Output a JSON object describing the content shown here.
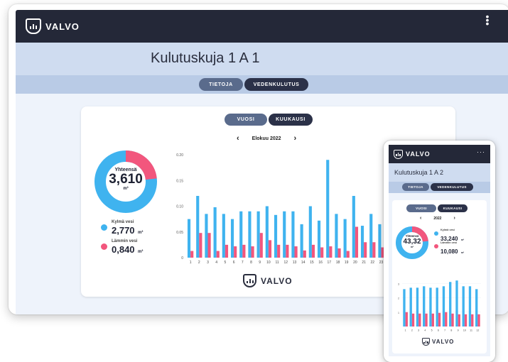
{
  "brand": {
    "name": "VALVO"
  },
  "desktop": {
    "title": "Kulutuskuja 1 A 1",
    "tabs": [
      "TIETOJA",
      "VEDENKULUTUS"
    ],
    "period_tabs": [
      "VUOSI",
      "KUUKAUSI"
    ],
    "month_label": "Elokuu 2022",
    "prev": "‹",
    "next": "›",
    "total_label": "Yhteensä",
    "total_value": "3,610",
    "total_unit": "m³",
    "cold_label": "Kylmä vesi",
    "cold_value": "2,770",
    "cold_unit": "m³",
    "warm_label": "Lämmin vesi",
    "warm_value": "0,840",
    "warm_unit": "m³"
  },
  "mobile": {
    "title": "Kulutuskuja 1 A 2",
    "tabs": [
      "TIETOJA",
      "VEDENKULUTUS"
    ],
    "period_tabs": [
      "VUOSI",
      "KUUKAUSI"
    ],
    "year_label": "2022",
    "prev": "‹",
    "next": "›",
    "total_label": "Yhteensä",
    "total_value": "43,32",
    "total_unit": "m³",
    "cold_label": "Kylmä vesi",
    "cold_value": "33,240",
    "cold_unit": "m³",
    "warm_label": "Lämmin vesi",
    "warm_value": "10,080",
    "warm_unit": "m³",
    "menu": "···"
  },
  "colors": {
    "cold": "#3fb3ef",
    "warm": "#f2567d",
    "dark": "#242838"
  },
  "chart_data": [
    {
      "type": "bar",
      "categories": [
        "1",
        "2",
        "3",
        "4",
        "5",
        "6",
        "7",
        "8",
        "9",
        "10",
        "11",
        "12",
        "13",
        "14",
        "15",
        "16",
        "17",
        "18",
        "19",
        "20",
        "21",
        "22",
        "23",
        "24",
        "25"
      ],
      "series": [
        {
          "name": "Kylmä vesi",
          "values": [
            0.075,
            0.12,
            0.085,
            0.098,
            0.085,
            0.075,
            0.09,
            0.09,
            0.09,
            0.1,
            0.083,
            0.09,
            0.09,
            0.065,
            0.1,
            0.072,
            0.19,
            0.085,
            0.075,
            0.12,
            0.062,
            0.085,
            0.065,
            0.075,
            0.062
          ]
        },
        {
          "name": "Lämmin vesi",
          "values": [
            0.013,
            0.048,
            0.048,
            0.013,
            0.025,
            0.022,
            0.025,
            0.022,
            0.048,
            0.034,
            0.025,
            0.025,
            0.022,
            0.014,
            0.025,
            0.02,
            0.022,
            0.018,
            0.013,
            0.06,
            0.03,
            0.03,
            0.02,
            0.02,
            0.02
          ]
        }
      ],
      "ylim": [
        0,
        0.2
      ],
      "yticks": [
        "0",
        "0.05",
        "0.10",
        "0.15",
        "0.20"
      ]
    },
    {
      "type": "bar",
      "categories": [
        "1",
        "2",
        "3",
        "4",
        "5",
        "6",
        "7",
        "8",
        "9",
        "10",
        "11",
        "12"
      ],
      "series": [
        {
          "name": "Kylmä vesi",
          "values": [
            2.6,
            2.7,
            2.7,
            2.8,
            2.7,
            2.7,
            2.8,
            3.1,
            3.2,
            2.8,
            2.8,
            2.6
          ]
        },
        {
          "name": "Lämmin vesi",
          "values": [
            1.0,
            0.9,
            0.9,
            0.9,
            0.9,
            0.95,
            1.0,
            0.9,
            0.85,
            0.85,
            0.85,
            0.85
          ]
        }
      ],
      "ylim": [
        0,
        4
      ],
      "yticks": [
        "1",
        "2",
        "3"
      ]
    }
  ]
}
